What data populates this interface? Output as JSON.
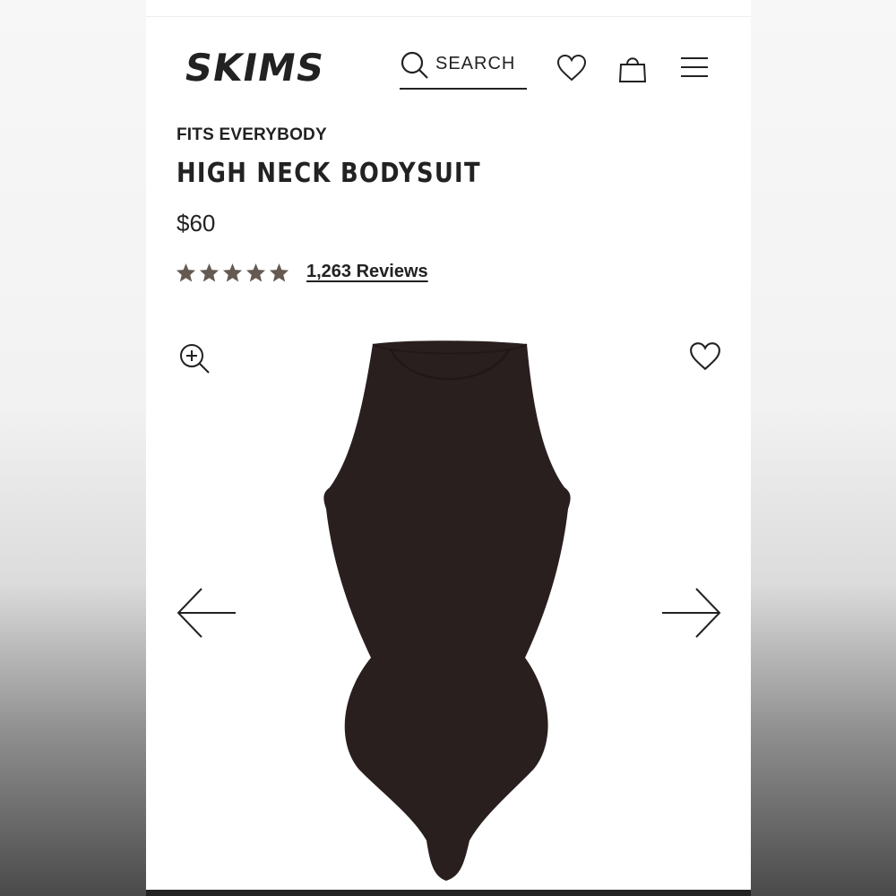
{
  "brand": {
    "name": "SKIMS"
  },
  "header": {
    "search_label": "SEARCH"
  },
  "product": {
    "collection": "FITS EVERYBODY",
    "title": "HIGH NECK BODYSUIT",
    "price": "$60",
    "rating_value": 5,
    "reviews_label": "1,263 Reviews",
    "color": "#2a1f1f"
  },
  "colors": {
    "text": "#222222",
    "star": "#645a52",
    "page": "#ffffff"
  },
  "icons": [
    "search-icon",
    "heart-icon",
    "bag-icon",
    "menu-icon",
    "zoom-in-icon",
    "wishlist-heart-icon",
    "arrow-left-icon",
    "arrow-right-icon"
  ]
}
